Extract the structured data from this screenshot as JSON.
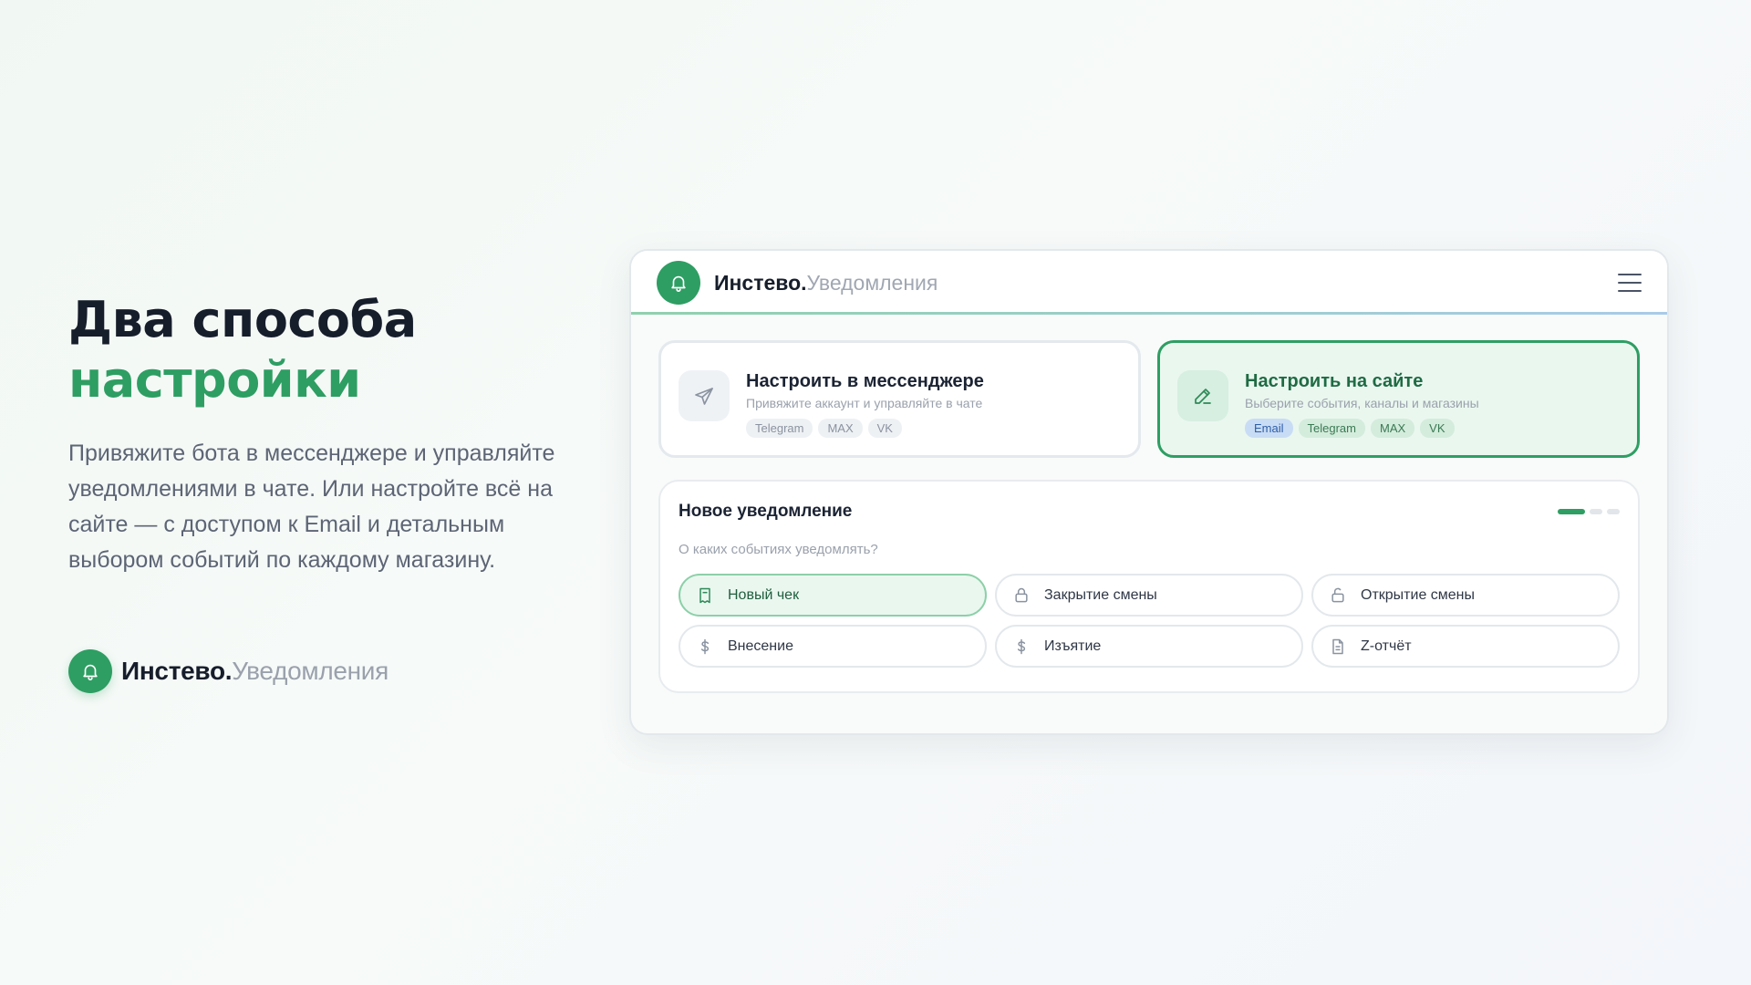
{
  "hero": {
    "title_line1": "Два способа",
    "title_line2": "настройки",
    "description": "Привяжите бота в мессенджере и управляйте уведомлениями в чате. Или настройте всё на сайте — с доступом к Email и детальным выбором событий по каждому магазину.",
    "brand_name": "Инстево.",
    "brand_sub": "Уведомления"
  },
  "window": {
    "brand_name": "Инстево.",
    "brand_sub": "Уведомления",
    "icons": {
      "brand": "bell-icon",
      "menu": "menu-icon"
    }
  },
  "cards": [
    {
      "title": "Настроить в мессенджере",
      "subtitle": "Привяжите аккаунт и управляйте в чате",
      "icon": "send-icon",
      "active": false,
      "chips": [
        "Telegram",
        "MAX",
        "VK"
      ]
    },
    {
      "title": "Настроить на сайте",
      "subtitle": "Выберите события, каналы и магазины",
      "icon": "pencil-icon",
      "active": true,
      "chips": [
        "Email",
        "Telegram",
        "MAX",
        "VK"
      ]
    }
  ],
  "notification": {
    "title": "Новое уведомление",
    "question": "О каких событиях уведомлять?",
    "step": 1,
    "steps_total": 3,
    "events": [
      {
        "label": "Новый чек",
        "icon": "receipt-icon",
        "selected": true
      },
      {
        "label": "Закрытие смены",
        "icon": "lock-icon",
        "selected": false
      },
      {
        "label": "Открытие смены",
        "icon": "unlock-icon",
        "selected": false
      },
      {
        "label": "Внесение",
        "icon": "dollar-icon",
        "selected": false
      },
      {
        "label": "Изъятие",
        "icon": "dollar-icon",
        "selected": false
      },
      {
        "label": "Z-отчёт",
        "icon": "document-icon",
        "selected": false
      }
    ]
  },
  "colors": {
    "accent": "#2e9e63",
    "accent_light": "#eaf7ef",
    "text_dark": "#161d2b",
    "text_muted": "#9aa1ac"
  }
}
